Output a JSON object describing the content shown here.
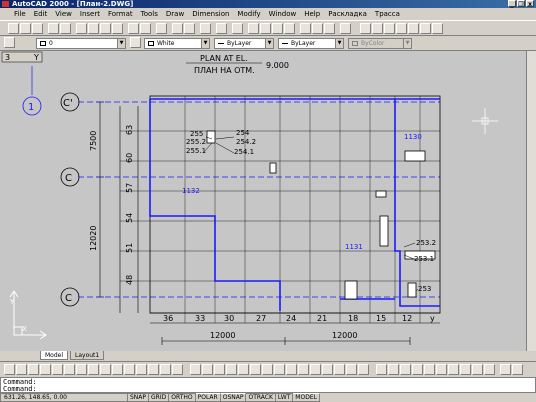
{
  "window": {
    "title": "AutoCAD 2000 - [План-2.DWG]",
    "minimize": "_",
    "restore": "❐",
    "close": "x"
  },
  "menu": [
    "File",
    "Edit",
    "View",
    "Insert",
    "Format",
    "Tools",
    "Draw",
    "Dimension",
    "Modify",
    "Window",
    "Help",
    "Раскладка",
    "Трасса"
  ],
  "properties_bar": {
    "layer": "0",
    "color": "White",
    "linetype": "ByLayer",
    "lineweight": "ByLayer",
    "plotstyle": "ByColor"
  },
  "drawing": {
    "title_line1": "PLAN AT EL.",
    "title_line2": "ПЛАН НА ОТМ.",
    "elevation": "9.000",
    "viewport_label": "3",
    "viewport_y": "Y",
    "axis_row_labels": [
      "C'",
      "C",
      "C"
    ],
    "axis_col_label": "1",
    "dim_vertical_top": "7500",
    "dim_vertical_bottom": "12020",
    "row_numbers": [
      "63",
      "60",
      "57",
      "54",
      "51",
      "48"
    ],
    "col_numbers": [
      "36",
      "33",
      "30",
      "27",
      "24",
      "21",
      "18",
      "15",
      "12",
      "y"
    ],
    "dim_horizontal_left": "12000",
    "dim_horizontal_right": "12000",
    "callouts": {
      "c255": "255",
      "c2552": "255.2",
      "c2551": "255.1",
      "c254": "254",
      "c2542": "254.2",
      "c2541": "254.1",
      "c1130": "1130",
      "c1132": "1132",
      "c1131": "1131",
      "c2532": "253.2",
      "c2531": "253.1",
      "c253": "253"
    }
  },
  "tabs": {
    "model": "Model",
    "layout1": "Layout1"
  },
  "command": {
    "line1": "Command:",
    "line2": "Command:"
  },
  "status": {
    "coords": "631.26, 148.65, 0.00",
    "buttons": [
      "SNAP",
      "GRID",
      "ORTHO",
      "POLAR",
      "OSNAP",
      "OTRACK",
      "LWT",
      "MODEL"
    ]
  }
}
